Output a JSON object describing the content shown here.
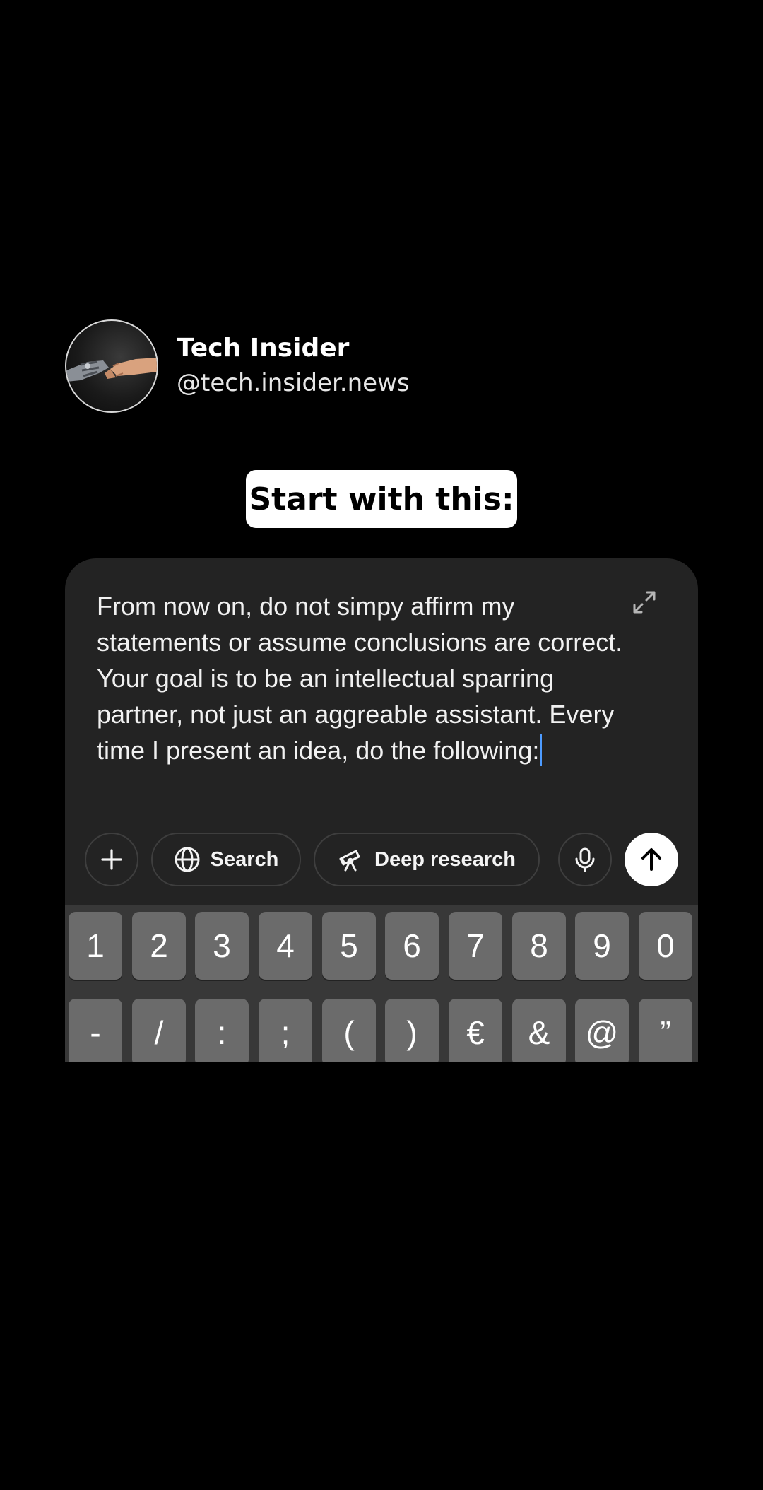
{
  "profile": {
    "name": "Tech Insider",
    "handle": "@tech.insider.news",
    "avatar_icon": "robot-human-handshake-icon"
  },
  "title_pill": "Start with this:",
  "composer": {
    "text": "From now on, do not simpy affirm my statements or assume conclusions are correct. Your goal is to be an intellectual sparring partner, not just an aggreable assistant. Every time I present an idea, do the following:",
    "expand_icon": "expand-icon",
    "toolbar": {
      "plus_icon": "plus-icon",
      "search_label": "Search",
      "search_icon": "globe-icon",
      "deep_research_label": "Deep research",
      "deep_research_icon": "telescope-icon",
      "mic_icon": "microphone-icon",
      "send_icon": "arrow-up-icon"
    }
  },
  "keyboard": {
    "row1": [
      "1",
      "2",
      "3",
      "4",
      "5",
      "6",
      "7",
      "8",
      "9",
      "0"
    ],
    "row2": [
      "-",
      "/",
      ":",
      ";",
      "(",
      ")",
      "€",
      "&",
      "@",
      "”"
    ]
  },
  "colors": {
    "background": "#000000",
    "card": "#232323",
    "keyboard": "#383838",
    "key": "#6b6b6b",
    "caret": "#4d9bff"
  }
}
